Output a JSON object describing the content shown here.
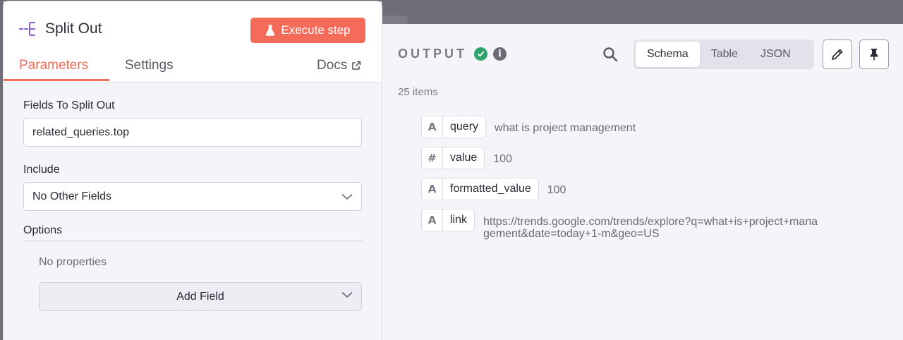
{
  "node": {
    "title": "Split Out",
    "icon": "split-out-icon",
    "execute_label": "Execute step",
    "tabs": [
      {
        "label": "Parameters",
        "active": true
      },
      {
        "label": "Settings",
        "active": false
      }
    ],
    "docs_label": "Docs"
  },
  "parameters": {
    "fields_to_split_label": "Fields To Split Out",
    "fields_to_split_value": "related_queries.top",
    "include_label": "Include",
    "include_value": "No Other Fields",
    "options_label": "Options",
    "no_properties": "No properties",
    "add_field_label": "Add Field"
  },
  "output": {
    "title": "OUTPUT",
    "status": "success",
    "items_count": "25 items",
    "views": [
      {
        "label": "Schema",
        "active": true
      },
      {
        "label": "Table",
        "active": false
      },
      {
        "label": "JSON",
        "active": false
      }
    ],
    "schema": [
      {
        "type": "A",
        "key": "query",
        "value": "what is project management"
      },
      {
        "type": "#",
        "key": "value",
        "value": "100"
      },
      {
        "type": "A",
        "key": "formatted_value",
        "value": "100"
      },
      {
        "type": "A",
        "key": "link",
        "value": "https://trends.google.com/trends/explore?q=what+is+project+management&date=today+1-m&geo=US"
      }
    ]
  },
  "colors": {
    "accent": "#f46b5a",
    "success": "#2ea36a"
  }
}
